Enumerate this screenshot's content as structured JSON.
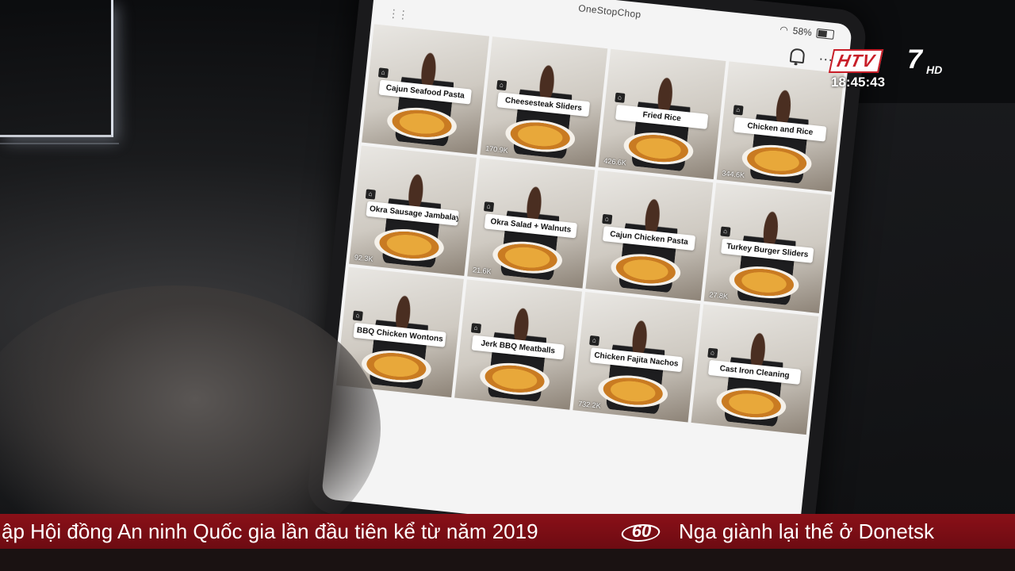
{
  "app": {
    "title": "OneStopChop",
    "battery_text": "58%",
    "drag_handle": "⋮⋮",
    "more_glyph": "···"
  },
  "tiles": [
    {
      "caption": "Cajun Seafood Pasta",
      "views": ""
    },
    {
      "caption": "Cheesesteak Sliders",
      "views": "170.9K"
    },
    {
      "caption": "Fried Rice",
      "views": "426.6K"
    },
    {
      "caption": "Chicken and Rice",
      "views": "344.6K"
    },
    {
      "caption": "Okra Sausage Jambalaya",
      "views": "92.3K"
    },
    {
      "caption": "Okra Salad + Walnuts",
      "views": "21.6K"
    },
    {
      "caption": "Cajun Chicken Pasta",
      "views": ""
    },
    {
      "caption": "Turkey Burger Sliders",
      "views": "27.8K"
    },
    {
      "caption": "BBQ Chicken Wontons",
      "views": ""
    },
    {
      "caption": "Jerk BBQ Meatballs",
      "views": ""
    },
    {
      "caption": "Chicken Fajita Nachos",
      "views": "732.2K"
    },
    {
      "caption": "Cast Iron Cleaning",
      "views": ""
    }
  ],
  "overlay": {
    "channel": "HTV",
    "channel_number": "7",
    "channel_quality": "HD",
    "clock": "18:45:43"
  },
  "ticker": {
    "left_text": "ập Hội đồng An ninh Quốc gia lần đầu tiên kể từ năm 2019",
    "badge": "60",
    "right_text": "Nga giành lại thế ở Donetsk"
  }
}
